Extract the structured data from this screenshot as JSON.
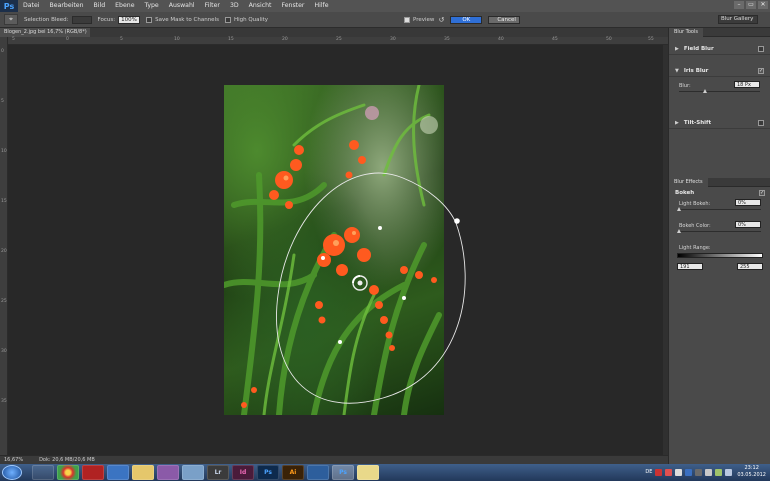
{
  "app": {
    "logo": "Ps",
    "menu": [
      "Datei",
      "Bearbeiten",
      "Bild",
      "Ebene",
      "Type",
      "Auswahl",
      "Filter",
      "3D",
      "Ansicht",
      "Fenster",
      "Hilfe"
    ]
  },
  "window_controls": [
    "–",
    "▭",
    "✕"
  ],
  "options": {
    "tool_icon": "focus-tool-icon",
    "selection_bleed_label": "Selection Bleed:",
    "selection_bleed_value": "",
    "focus_label": "Focus:",
    "focus_value": "100%",
    "save_mask_label": "Save Mask to Channels",
    "high_quality_label": "High Quality",
    "preview_label": "Preview",
    "ok_label": "OK",
    "cancel_label": "Cancel",
    "workspace_label": "Blur Gallery"
  },
  "document": {
    "tab_title": "Blogen_2.jpg bei 16,7% (RGB/8*)",
    "close_glyph": "×"
  },
  "ruler": {
    "h_ticks": [
      "5",
      "0",
      "5",
      "10",
      "15",
      "20",
      "25",
      "30",
      "35",
      "40",
      "45",
      "50",
      "55",
      "60"
    ],
    "v_ticks": [
      "0",
      "5",
      "10",
      "15",
      "20",
      "25",
      "30",
      "35"
    ]
  },
  "status": {
    "zoom": "16,67%",
    "doc": "Dok: 20,6 MB/20,6 MB"
  },
  "blur_tools": {
    "tab": "Blur Tools",
    "items": [
      {
        "label": "Field Blur",
        "enabled": false
      },
      {
        "label": "Iris Blur",
        "enabled": true
      },
      {
        "label": "Tilt-Shift",
        "enabled": false
      }
    ],
    "blur_label": "Blur:",
    "blur_value": "18 Px",
    "blur_level": 0.32
  },
  "blur_effects": {
    "tab": "Blur Effects",
    "bokeh_label": "Bokeh",
    "light_bokeh_label": "Light Bokeh:",
    "light_bokeh_value": "0%",
    "bokeh_color_label": "Bokeh Color:",
    "bokeh_color_value": "0%",
    "light_range_label": "Light Range:",
    "range_low": "191",
    "range_high": "255"
  },
  "taskbar": {
    "apps": [
      "explorer-app-icon",
      "chrome-app-icon",
      "filezilla-app-icon",
      "thunderbird-app-icon",
      "folder-app-icon",
      "indesign-app-icon",
      "explorer2-app-icon",
      "lightroom-app-icon",
      "indesign2-app-icon",
      "photoshop-app-icon",
      "illustrator-app-icon",
      "camera-app-icon",
      "photoshop-active-app-icon",
      "folder2-app-icon"
    ],
    "app_glyphs": [
      "",
      "",
      "",
      "",
      "",
      "",
      "",
      "Lr",
      "Id",
      "Ps",
      "Ai",
      "",
      "Ps",
      ""
    ],
    "tray_lang": "DE",
    "clock_time": "23:12",
    "clock_date": "03.05.2012"
  },
  "colors": {
    "ok_blue": "#2f6fd6",
    "panel": "#4a4a4a",
    "canvas": "#282828",
    "flower_orange": "#ff5a1f"
  }
}
